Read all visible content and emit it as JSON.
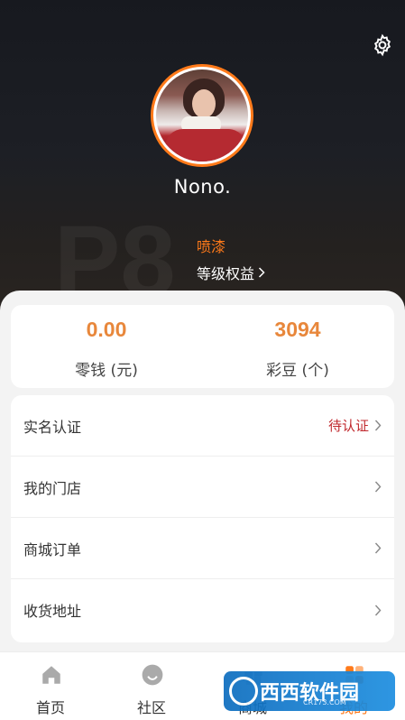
{
  "profile": {
    "username": "Nono.",
    "level_code": "P8",
    "level_name": "喷漆",
    "level_link": "等级权益"
  },
  "wallet": {
    "change": {
      "value": "0.00",
      "label": "零钱 (元)"
    },
    "beans": {
      "value": "3094",
      "label": "彩豆 (个)"
    }
  },
  "menu": {
    "items": [
      {
        "label": "实名认证",
        "status": "待认证"
      },
      {
        "label": "我的门店",
        "status": ""
      },
      {
        "label": "商城订单",
        "status": ""
      },
      {
        "label": "收货地址",
        "status": ""
      }
    ]
  },
  "tabbar": {
    "tabs": [
      {
        "label": "首页",
        "icon": "home-icon"
      },
      {
        "label": "社区",
        "icon": "smile-icon"
      },
      {
        "label": "商城",
        "icon": "gift-icon"
      },
      {
        "label": "我的",
        "icon": "grid-icon"
      }
    ]
  },
  "watermark": {
    "text": "西西软件园",
    "sub": "CR173.COM"
  },
  "colors": {
    "accent": "#ff7a1a",
    "pending": "#c0282d",
    "value": "#e8873b"
  }
}
